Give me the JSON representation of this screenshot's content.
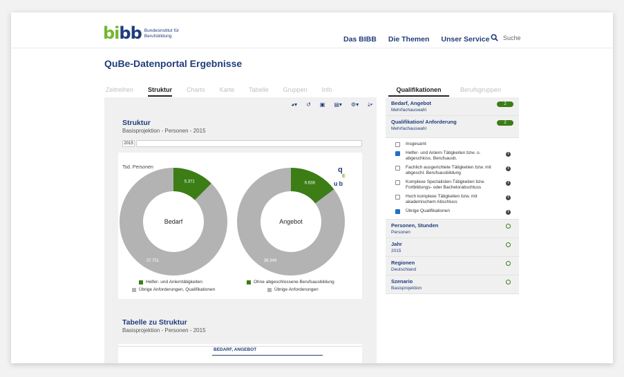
{
  "header": {
    "logo_text_1": "Bundesinstitut für",
    "logo_text_2": "Berufsbildung",
    "nav": [
      "Das BIBB",
      "Die Themen",
      "Unser Service"
    ],
    "search_label": "Suche"
  },
  "page_title": "QuBe-Datenportal Ergebnisse",
  "tabs": [
    "Zeitreihen",
    "Struktur",
    "Charts",
    "Karte",
    "Tabelle",
    "Gruppen",
    "Info"
  ],
  "active_tab": "Struktur",
  "right_tabs": [
    "Qualifikationen",
    "Berufsgruppen"
  ],
  "structure": {
    "title": "Struktur",
    "subtitle": "Basisprojektion - Personen - 2015",
    "year": "2015",
    "unit": "Tsd. Personen"
  },
  "chart_data": {
    "type": "pie",
    "title": "Struktur",
    "charts": [
      {
        "center_label": "Bedarf",
        "slices": [
          {
            "name": "Helfer- und Anlerntätigkeiten",
            "value": 5371,
            "label": "5.371",
            "color": "#3c7d16"
          },
          {
            "name": "Übrige Anforderungen, Qualifikationen",
            "value": 37751,
            "label": "37.751",
            "color": "#b3b3b3"
          }
        ]
      },
      {
        "center_label": "Angebot",
        "slices": [
          {
            "name": "Ohne abgeschlossene Berufsausbildung",
            "value": 6638,
            "label": "6.638",
            "color": "#3c7d16"
          },
          {
            "name": "Übrige Anforderungen",
            "value": 38349,
            "label": "38.349",
            "color": "#b3b3b3"
          }
        ]
      }
    ]
  },
  "table_section": {
    "title": "Tabelle zu Struktur",
    "subtitle": "Basisprojektion - Personen - 2015",
    "header": "BEDARF, ANGEBOT"
  },
  "facets": [
    {
      "title": "Bedarf, Angebot",
      "sub": "Mehrfachauswahl",
      "badge": "2"
    },
    {
      "title": "Qualifikation/ Anforderung",
      "sub": "Mehrfachauswahl",
      "badge": "2"
    }
  ],
  "checkboxes": [
    {
      "label": "Insgesamt",
      "checked": false,
      "info": false
    },
    {
      "label": "Helfer- und Anlern-Tätigkeiten bzw. o. abgeschloss. Berufsausb.",
      "checked": true,
      "info": true
    },
    {
      "label": "Fachlich ausgerichtete Tätigkeiten bzw. mit abgeschl. Berufsausbildung",
      "checked": false,
      "info": true
    },
    {
      "label": "Komplexe Spezialisten-Tätigkeiten bzw. Fortbildungs- oder Bachelorabschluss",
      "checked": false,
      "info": true
    },
    {
      "label": "Hoch komplexe Tätigkeiten bzw. mit akademischem Abschluss",
      "checked": false,
      "info": true
    },
    {
      "label": "Übrige Qualifikationen",
      "checked": true,
      "info": true
    }
  ],
  "facets_more": [
    {
      "title": "Personen, Stunden",
      "sub": "Personen"
    },
    {
      "title": "Jahr",
      "sub": "2015"
    },
    {
      "title": "Regionen",
      "sub": "Deutschland"
    },
    {
      "title": "Szenario",
      "sub": "Basisprojektion"
    }
  ],
  "colors": {
    "brand_blue": "#1f3d7a",
    "brand_green": "#74b72e",
    "accent_green": "#3c7d16",
    "other_grey": "#b3b3b3"
  }
}
